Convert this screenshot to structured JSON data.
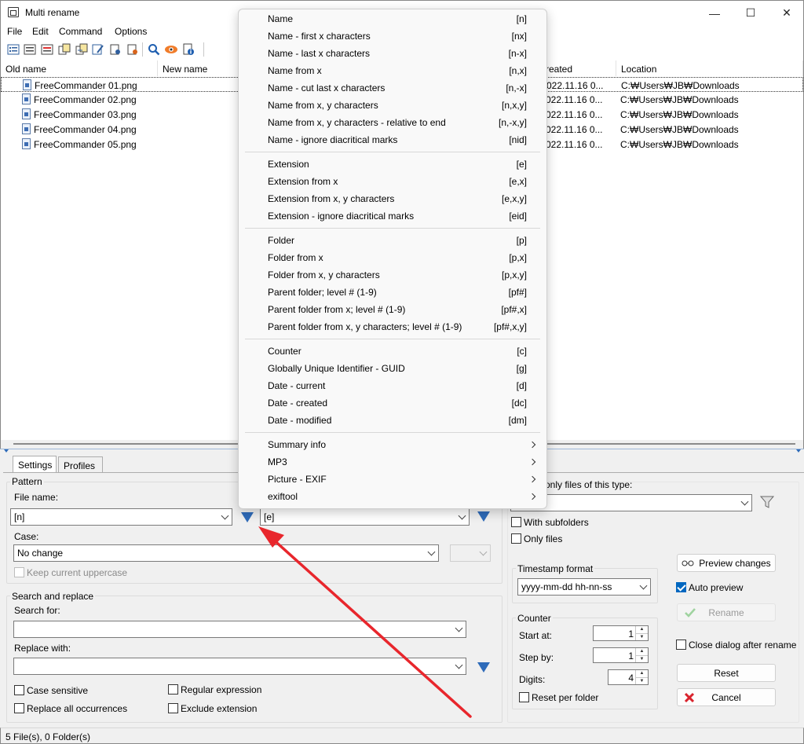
{
  "window": {
    "title": "Multi rename",
    "minimize": "—",
    "maximize": "☐",
    "close": "✕"
  },
  "menubar": [
    "File",
    "Edit",
    "Command",
    "Options"
  ],
  "toolbar_icons": [
    "add-files-icon",
    "add-list-icon",
    "clear-list-icon",
    "copy-files-icon",
    "move-files-icon",
    "edit-icon",
    "select-icon",
    "deselect-icon",
    "search-icon",
    "preview-eye-icon",
    "file-info-icon"
  ],
  "columns": {
    "old_name": "Old name",
    "new_name": "New name",
    "created": "reated",
    "location": "Location"
  },
  "files": [
    {
      "name": "FreeCommander 01.png",
      "created": "022.11.16 0...",
      "location": "C:₩Users₩JB₩Downloads"
    },
    {
      "name": "FreeCommander 02.png",
      "created": "022.11.16 0...",
      "location": "C:₩Users₩JB₩Downloads"
    },
    {
      "name": "FreeCommander 03.png",
      "created": "022.11.16 0...",
      "location": "C:₩Users₩JB₩Downloads"
    },
    {
      "name": "FreeCommander 04.png",
      "created": "022.11.16 0...",
      "location": "C:₩Users₩JB₩Downloads"
    },
    {
      "name": "FreeCommander 05.png",
      "created": "022.11.16 0...",
      "location": "C:₩Users₩JB₩Downloads"
    }
  ],
  "tabs": {
    "settings": "Settings",
    "profiles": "Profiles"
  },
  "pattern": {
    "group": "Pattern",
    "file_name_label": "File name:",
    "file_name_value": "[n]",
    "ext_value": "[e]",
    "case_label": "Case:",
    "case_value": "No change",
    "keep_uppercase": "Keep current uppercase"
  },
  "search_replace": {
    "group": "Search and replace",
    "search_label": "Search for:",
    "replace_label": "Replace with:",
    "case_sensitive": "Case sensitive",
    "regex": "Regular expression",
    "replace_all": "Replace all occurrences",
    "exclude_ext": "Exclude extension"
  },
  "filter": {
    "label": "only files of this type:",
    "with_subfolders": "With subfolders",
    "only_files": "Only files"
  },
  "timestamp": {
    "group": "Timestamp format",
    "value": "yyyy-mm-dd hh-nn-ss"
  },
  "counter": {
    "group": "Counter",
    "start_label": "Start at:",
    "start_value": "1",
    "step_label": "Step by:",
    "step_value": "1",
    "digits_label": "Digits:",
    "digits_value": "4",
    "reset_per_folder": "Reset per folder"
  },
  "buttons": {
    "preview": "Preview changes",
    "auto_preview": "Auto preview",
    "rename": "Rename",
    "close_after": "Close dialog after rename",
    "reset": "Reset",
    "cancel": "Cancel"
  },
  "status": "5 File(s), 0 Folder(s)",
  "menu": {
    "groups": [
      [
        {
          "label": "Name",
          "code": "[n]"
        },
        {
          "label": "Name - first x characters",
          "code": "[nx]"
        },
        {
          "label": "Name - last x characters",
          "code": "[n-x]"
        },
        {
          "label": "Name from x",
          "code": "[n,x]"
        },
        {
          "label": "Name - cut last x characters",
          "code": "[n,-x]"
        },
        {
          "label": "Name from x, y characters",
          "code": "[n,x,y]"
        },
        {
          "label": "Name from x, y characters - relative to end",
          "code": "[n,-x,y]"
        },
        {
          "label": "Name - ignore diacritical marks",
          "code": "[nid]"
        }
      ],
      [
        {
          "label": "Extension",
          "code": "[e]"
        },
        {
          "label": "Extension from x",
          "code": "[e,x]"
        },
        {
          "label": "Extension from x, y characters",
          "code": "[e,x,y]"
        },
        {
          "label": "Extension - ignore diacritical marks",
          "code": "[eid]"
        }
      ],
      [
        {
          "label": "Folder",
          "code": "[p]"
        },
        {
          "label": "Folder from x",
          "code": "[p,x]"
        },
        {
          "label": "Folder from x, y characters",
          "code": "[p,x,y]"
        },
        {
          "label": "Parent folder; level # (1-9)",
          "code": "[pf#]"
        },
        {
          "label": "Parent folder from x; level # (1-9)",
          "code": "[pf#,x]"
        },
        {
          "label": "Parent folder from x, y characters; level # (1-9)",
          "code": "[pf#,x,y]"
        }
      ],
      [
        {
          "label": "Counter",
          "code": "[c]"
        },
        {
          "label": "Globally Unique Identifier - GUID",
          "code": "[g]"
        },
        {
          "label": "Date - current",
          "code": "[d]"
        },
        {
          "label": "Date - created",
          "code": "[dc]"
        },
        {
          "label": "Date - modified",
          "code": "[dm]"
        }
      ],
      [
        {
          "label": "Summary info",
          "code": "",
          "submenu": true
        },
        {
          "label": "MP3",
          "code": "",
          "submenu": true
        },
        {
          "label": "Picture - EXIF",
          "code": "",
          "submenu": true
        },
        {
          "label": "exiftool",
          "code": "",
          "submenu": true
        }
      ]
    ]
  },
  "colors": {
    "accent": "#0067c0",
    "arrow": "#e8262c",
    "triangle": "#2e6bb9"
  }
}
